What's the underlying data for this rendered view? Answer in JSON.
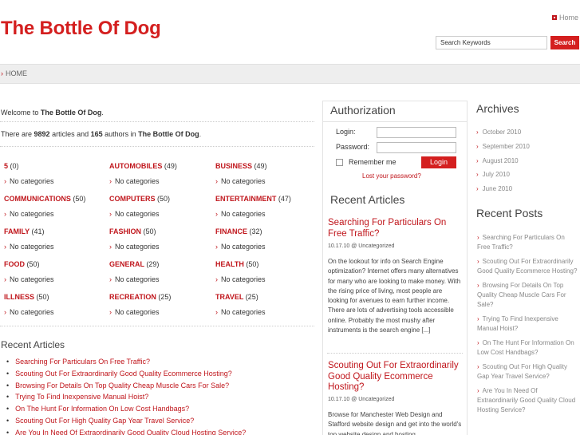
{
  "header": {
    "site_title": "The Bottle Of Dog",
    "home_label": "Home",
    "search_placeholder": "Search Keywords",
    "search_button": "Search"
  },
  "breadcrumb": {
    "arrow": "›",
    "label": "HOME"
  },
  "intro": {
    "welcome_prefix": "Welcome to ",
    "welcome_site": "The Bottle Of Dog",
    "welcome_suffix": ".",
    "stats_prefix": "There are ",
    "articles_count": "9892",
    "stats_mid": " articles and ",
    "authors_count": "165",
    "stats_mid2": " authors in ",
    "stats_site": "The Bottle Of Dog",
    "stats_suffix": "."
  },
  "categories": [
    {
      "name": "5",
      "count": "(0)",
      "sub": "No categories"
    },
    {
      "name": "AUTOMOBILES",
      "count": "(49)",
      "sub": "No categories"
    },
    {
      "name": "BUSINESS",
      "count": "(49)",
      "sub": "No categories"
    },
    {
      "name": "COMMUNICATIONS",
      "count": "(50)",
      "sub": "No categories"
    },
    {
      "name": "COMPUTERS",
      "count": "(50)",
      "sub": "No categories"
    },
    {
      "name": "ENTERTAINMENT",
      "count": "(47)",
      "sub": "No categories"
    },
    {
      "name": "FAMILY",
      "count": "(41)",
      "sub": "No categories"
    },
    {
      "name": "FASHION",
      "count": "(50)",
      "sub": "No categories"
    },
    {
      "name": "FINANCE",
      "count": "(32)",
      "sub": "No categories"
    },
    {
      "name": "FOOD",
      "count": "(50)",
      "sub": "No categories"
    },
    {
      "name": "GENERAL",
      "count": "(29)",
      "sub": "No categories"
    },
    {
      "name": "HEALTH",
      "count": "(50)",
      "sub": "No categories"
    },
    {
      "name": "ILLNESS",
      "count": "(50)",
      "sub": "No categories"
    },
    {
      "name": "RECREATION",
      "count": "(25)",
      "sub": "No categories"
    },
    {
      "name": "TRAVEL",
      "count": "(25)",
      "sub": "No categories"
    }
  ],
  "recent_articles": {
    "heading": "Recent Articles",
    "items": [
      "Searching For Particulars On Free Traffic?",
      "Scouting Out For Extraordinarily Good Quality Ecommerce Hosting?",
      "Browsing For Details On Top Quality Cheap Muscle Cars For Sale?",
      "Trying To Find Inexpensive Manual Hoist?",
      "On The Hunt For Information On Low Cost Handbags?",
      "Scouting Out For High Quality Gap Year Travel Service?",
      "Are You In Need Of Extraordinarily Good Quality Cloud Hosting Service?"
    ]
  },
  "authorization": {
    "heading": "Authorization",
    "login_label": "Login:",
    "password_label": "Password:",
    "remember_label": "Remember me",
    "login_button": "Login",
    "lost_password": "Lost your password?"
  },
  "sidebar_recent": {
    "heading": "Recent Articles",
    "posts": [
      {
        "title": "Searching For Particulars On Free Traffic?",
        "meta": "10.17.10 @ Uncategorized",
        "excerpt": "On the lookout for info on Search Engine optimization? Internet offers many alternatives for many who are looking to make money. With the rising price of living, most people are looking for avenues to earn further income. There are lots of advertising tools accessible online. Probably the most mushy after instruments is the search engine [...]"
      },
      {
        "title": "Scouting Out For Extraordinarily Good Quality Ecommerce Hosting?",
        "meta": "10.17.10 @ Uncategorized",
        "excerpt": "Browse for Manchester Web Design and Stafford website design and get into the world's top website design and hosting"
      }
    ]
  },
  "archives": {
    "heading": "Archives",
    "items": [
      "October 2010",
      "September 2010",
      "August 2010",
      "July 2010",
      "June 2010"
    ]
  },
  "recent_posts": {
    "heading": "Recent Posts",
    "items": [
      "Searching For Particulars On Free Traffic?",
      "Scouting Out For Extraordinarily Good Quality Ecommerce Hosting?",
      "Browsing For Details On Top Quality Cheap Muscle Cars For Sale?",
      "Trying To Find Inexpensive Manual Hoist?",
      "On The Hunt For Information On Low Cost Handbags?",
      "Scouting Out For High Quality Gap Year Travel Service?",
      "Are You In Need Of Extraordinarily Good Quality Cloud Hosting Service?"
    ]
  },
  "colors": {
    "accent": "#d41f1f",
    "link": "#c0161c",
    "crumb_bg": "#eeeeee"
  }
}
